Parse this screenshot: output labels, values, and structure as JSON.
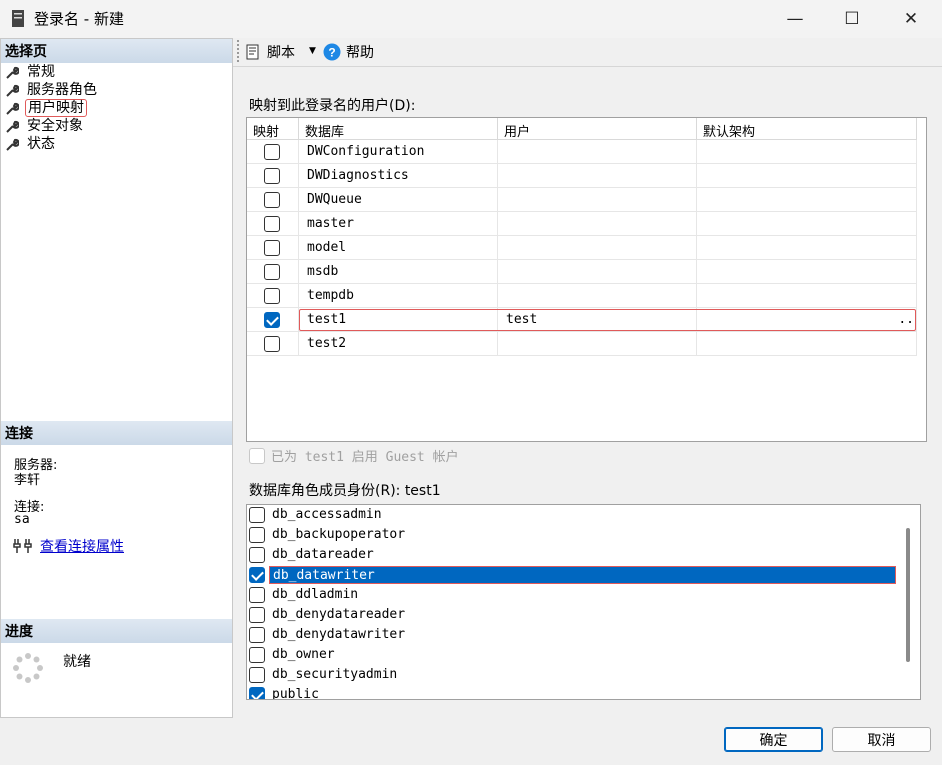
{
  "window": {
    "title": "登录名 - 新建",
    "controls": {
      "minimize": "—",
      "maximize": "☐",
      "close": "✕"
    }
  },
  "left": {
    "select_page_header": "选择页",
    "nav": [
      "常规",
      "服务器角色",
      "用户映射",
      "安全对象",
      "状态"
    ],
    "selected_nav": "用户映射",
    "connection_header": "连接",
    "server_label": "服务器:",
    "server_value": "李轩",
    "connection_label": "连接:",
    "connection_value": "sa",
    "view_props_link": "查看连接属性",
    "progress_header": "进度",
    "progress_status": "就绪"
  },
  "toolbar": {
    "script_label": "脚本",
    "help_label": "帮助",
    "icons": [
      "script-icon",
      "dropdown-arrow-icon",
      "help-icon"
    ]
  },
  "mapping": {
    "label": "映射到此登录名的用户(D):",
    "columns": [
      "映射",
      "数据库",
      "用户",
      "默认架构"
    ],
    "rows": [
      {
        "mapped": false,
        "db": "DWConfiguration",
        "user": "",
        "schema": ""
      },
      {
        "mapped": false,
        "db": "DWDiagnostics",
        "user": "",
        "schema": ""
      },
      {
        "mapped": false,
        "db": "DWQueue",
        "user": "",
        "schema": ""
      },
      {
        "mapped": false,
        "db": "master",
        "user": "",
        "schema": ""
      },
      {
        "mapped": false,
        "db": "model",
        "user": "",
        "schema": ""
      },
      {
        "mapped": false,
        "db": "msdb",
        "user": "",
        "schema": ""
      },
      {
        "mapped": false,
        "db": "tempdb",
        "user": "",
        "schema": ""
      },
      {
        "mapped": true,
        "db": "test1",
        "user": "test",
        "schema": ".."
      },
      {
        "mapped": false,
        "db": "test2",
        "user": "",
        "schema": ""
      }
    ]
  },
  "guest": {
    "label": "已为 test1 启用 Guest 帐户",
    "checked": false,
    "enabled": false
  },
  "roles": {
    "label": "数据库角色成员身份(R): test1",
    "items": [
      {
        "name": "db_accessadmin",
        "checked": false
      },
      {
        "name": "db_backupoperator",
        "checked": false
      },
      {
        "name": "db_datareader",
        "checked": false
      },
      {
        "name": "db_datawriter",
        "checked": true,
        "selected": true
      },
      {
        "name": "db_ddladmin",
        "checked": false
      },
      {
        "name": "db_denydatareader",
        "checked": false
      },
      {
        "name": "db_denydatawriter",
        "checked": false
      },
      {
        "name": "db_owner",
        "checked": false
      },
      {
        "name": "db_securityadmin",
        "checked": false
      },
      {
        "name": "public",
        "checked": true
      }
    ]
  },
  "buttons": {
    "ok": "确定",
    "cancel": "取消"
  },
  "colors": {
    "accent": "#0067c0",
    "highlight_outline": "#e05a5a",
    "header_gradient": "#cbd9e8"
  }
}
